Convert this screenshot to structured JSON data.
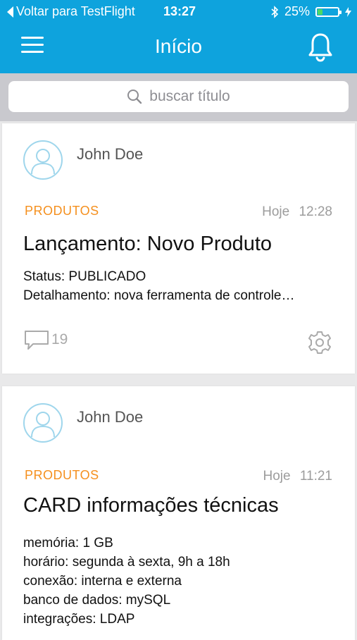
{
  "status_bar": {
    "back_label": "Voltar para TestFlight",
    "time": "13:27",
    "battery": "25%",
    "battery_level": 0.25
  },
  "navbar": {
    "title": "Início",
    "menu_icon": "hamburger-menu-icon",
    "notifications_icon": "bell-icon"
  },
  "search": {
    "placeholder": "buscar título",
    "icon": "search-icon"
  },
  "posts": [
    {
      "author": "John Doe",
      "category": "PRODUTOS",
      "date": "Hoje",
      "time": "12:28",
      "title": "Lançamento: Novo Produto",
      "details": [
        "Status: PUBLICADO",
        "Detalhamento: nova ferramenta de controle…"
      ],
      "comments": "19"
    },
    {
      "author": "John Doe",
      "category": "PRODUTOS",
      "date": "Hoje",
      "time": "11:21",
      "title": "CARD informações técnicas",
      "details": [
        "memória: 1 GB",
        "horário: segunda à sexta, 9h a 18h",
        "conexão: interna e externa",
        "banco de dados: mySQL",
        "integrações: LDAP"
      ]
    }
  ],
  "colors": {
    "header": "#0ea3dd",
    "category": "#f5901e",
    "avatar_border": "#9fd6ec",
    "background": "#e9e9ea"
  }
}
